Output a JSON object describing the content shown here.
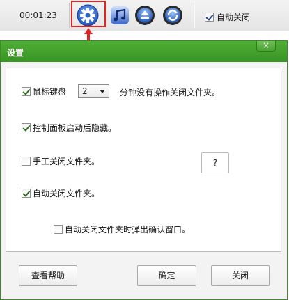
{
  "toolbar": {
    "timer": "00:01:23",
    "icons": [
      "settings-gear-icon",
      "music-note-icon",
      "eject-disc-icon",
      "refresh-icon"
    ],
    "auto_close_label": "自动关闭",
    "auto_close_checked": true,
    "highlight_color": "#e02424"
  },
  "dialog": {
    "title": "设置",
    "close_glyph": "×",
    "accent": "#3f9a2a",
    "options": {
      "mouse_keyboard": {
        "label": "鼠标键盘",
        "checked": true
      },
      "minutes_value": "2",
      "minutes_suffix": "分钟没有操作关闭文件夹。",
      "hide_on_start": {
        "label": "控制面板启动后隐藏。",
        "checked": true
      },
      "manual_close": {
        "label": "手工关闭文件夹。",
        "checked": false
      },
      "help_q": "?",
      "auto_close_folder": {
        "label": "自动关闭文件夹。",
        "checked": true
      },
      "confirm_popup": {
        "label": "自动关闭文件夹时弹出确认窗口。",
        "checked": false
      }
    },
    "buttons": {
      "help": "查看帮助",
      "ok": "确定",
      "close": "关闭"
    }
  }
}
